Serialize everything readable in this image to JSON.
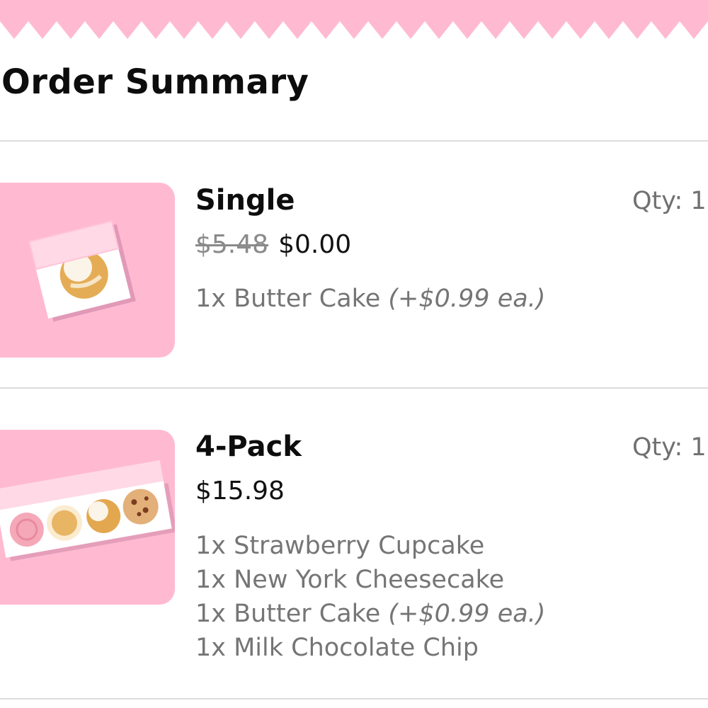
{
  "page": {
    "title": "Order Summary"
  },
  "colors": {
    "banner_pink": "#ffbad1",
    "thumb_pink": "#ffbad1",
    "divider": "#dcdcdc",
    "muted_text": "#757575"
  },
  "items": [
    {
      "name": "Single",
      "qty": "Qty: 1",
      "original_price": "$5.48",
      "price": "$0.00",
      "image_icon": "single-cookie-box-icon",
      "lines": [
        {
          "text": "1x Butter Cake",
          "upcharge": "(+$0.99 ea.)"
        }
      ]
    },
    {
      "name": "4-Pack",
      "qty": "Qty: 1",
      "price": "$15.98",
      "image_icon": "four-pack-cookie-box-icon",
      "lines": [
        {
          "text": "1x Strawberry Cupcake",
          "upcharge": ""
        },
        {
          "text": "1x New York Cheesecake",
          "upcharge": ""
        },
        {
          "text": "1x Butter Cake",
          "upcharge": "(+$0.99 ea.)"
        },
        {
          "text": "1x Milk Chocolate Chip",
          "upcharge": ""
        }
      ]
    }
  ]
}
